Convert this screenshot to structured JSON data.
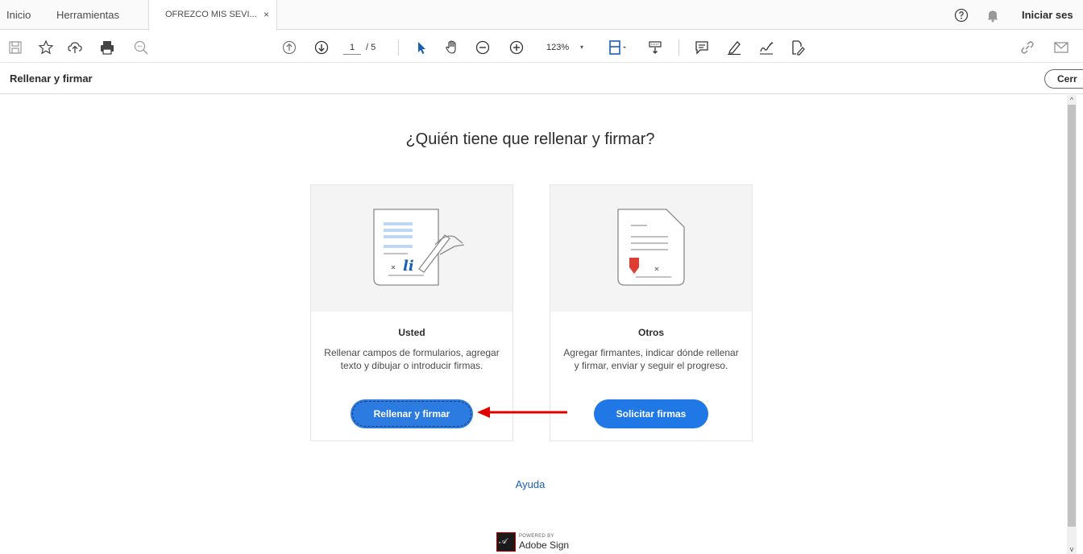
{
  "tabs": {
    "inicio": "Inicio",
    "herramientas": "Herramientas",
    "document": "OFREZCO MIS SEVI...",
    "close_glyph": "×"
  },
  "topbar": {
    "login": "Iniciar ses"
  },
  "toolbar": {
    "page_current": "1",
    "page_total": "/ 5",
    "zoom": "123%",
    "zoom_dropdown": "▾"
  },
  "panel": {
    "title": "Rellenar y firmar",
    "close_label": "Cerr"
  },
  "main": {
    "question": "¿Quién tiene que rellenar y firmar?",
    "cards": [
      {
        "title": "Usted",
        "description": "Rellenar campos de formularios, agregar texto y dibujar o introducir firmas.",
        "button": "Rellenar y firmar"
      },
      {
        "title": "Otros",
        "description": "Agregar firmantes, indicar dónde rellenar y firmar, enviar y seguir el progreso.",
        "button": "Solicitar firmas"
      }
    ],
    "help": "Ayuda",
    "powered_by": "POWERED BY",
    "brand": "Adobe Sign"
  },
  "colors": {
    "accent": "#1f78e6",
    "arrow": "#e00000",
    "link": "#1a5fb4"
  }
}
